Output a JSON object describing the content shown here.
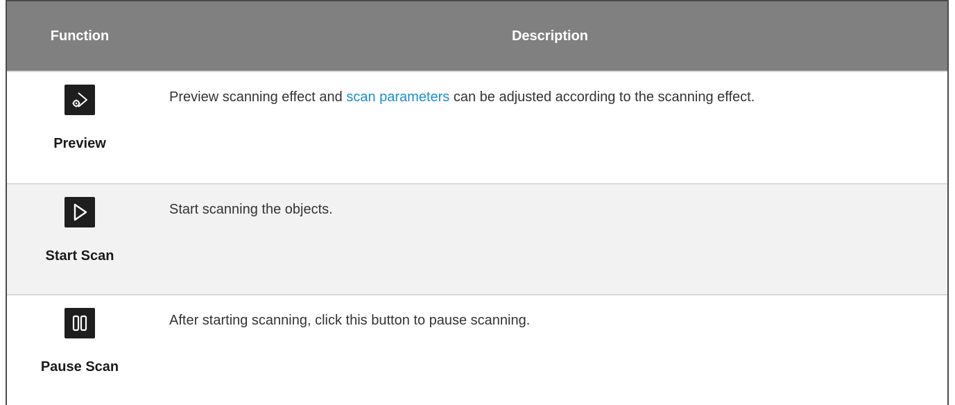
{
  "header": {
    "function": "Function",
    "description": "Description"
  },
  "rows": [
    {
      "label": "Preview",
      "icon": "preview-icon",
      "desc_before": "Preview scanning effect and ",
      "desc_link": "scan parameters",
      "desc_after": " can be adjusted according to the scanning effect."
    },
    {
      "label": "Start Scan",
      "icon": "play-icon",
      "desc": "Start scanning the objects."
    },
    {
      "label": "Pause Scan",
      "icon": "pause-icon",
      "desc": "After starting scanning, click this button to pause scanning."
    }
  ],
  "colors": {
    "header_bg": "#808080",
    "link": "#1a8fd1",
    "icon_bg": "#1e1e1e"
  }
}
